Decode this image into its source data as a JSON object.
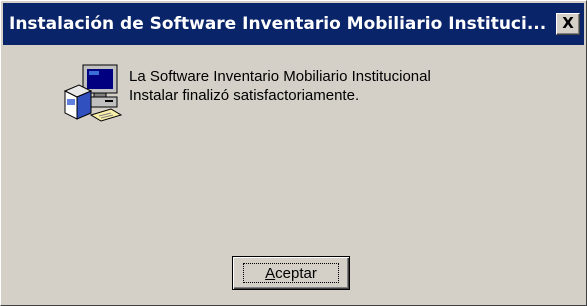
{
  "dialog": {
    "title": "Instalación de Software Inventario Mobiliario Instituci...",
    "close_label": "X",
    "icon": "computer-setup-icon",
    "message_line1": "La Software Inventario Mobiliario Institucional",
    "message_line2": "Instalar finalizó satisfactoriamente.",
    "ok_label": "Aceptar"
  },
  "colors": {
    "titlebar": "#0a246a",
    "face": "#d4d0c8"
  }
}
